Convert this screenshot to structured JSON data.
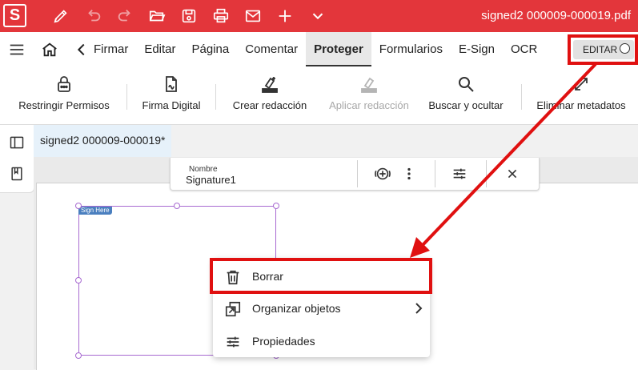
{
  "title_bar": {
    "app_logo": "S",
    "document_title": "signed2 000009-000019.pdf",
    "icons": [
      "pen-icon",
      "undo-icon",
      "redo-icon",
      "open-folder-icon",
      "save-icon",
      "print-icon",
      "mail-icon",
      "plus-icon",
      "chevron-down-icon"
    ]
  },
  "menu_bar": {
    "tabs": [
      {
        "label": "Firmar"
      },
      {
        "label": "Editar"
      },
      {
        "label": "Página"
      },
      {
        "label": "Comentar"
      },
      {
        "label": "Proteger",
        "active": true
      },
      {
        "label": "Formularios"
      },
      {
        "label": "E-Sign"
      },
      {
        "label": "OCR"
      }
    ],
    "edit_toggle": "EDITAR"
  },
  "toolbar": {
    "tools": [
      {
        "label": "Restringir Permisos",
        "icon": "lock-icon",
        "enabled": true
      },
      {
        "label": "Firma Digital",
        "icon": "digital-signature-icon",
        "enabled": true
      },
      {
        "label": "Crear redacción",
        "icon": "create-redaction-icon",
        "enabled": true
      },
      {
        "label": "Aplicar redacción",
        "icon": "apply-redaction-icon",
        "enabled": false
      },
      {
        "label": "Buscar y ocultar",
        "icon": "search-icon",
        "enabled": true
      },
      {
        "label": "Eliminar metadatos",
        "icon": "remove-metadata-icon",
        "enabled": true
      }
    ]
  },
  "document_tab": {
    "label": "signed2 000009-000019*"
  },
  "field_toolbar": {
    "name_label": "Nombre",
    "name_value": "Signature1"
  },
  "signature_field": {
    "tag": "Sign Here"
  },
  "context_menu": {
    "items": [
      {
        "label": "Borrar",
        "icon": "trash-icon"
      },
      {
        "label": "Organizar objetos",
        "icon": "arrange-objects-icon",
        "has_submenu": true
      },
      {
        "label": "Propiedades",
        "icon": "properties-icon"
      }
    ]
  },
  "colors": {
    "title_bar": "#e3363b",
    "highlight": "#e01010",
    "field_border": "#a86bd1",
    "document_tab": "#e6f1fa"
  }
}
